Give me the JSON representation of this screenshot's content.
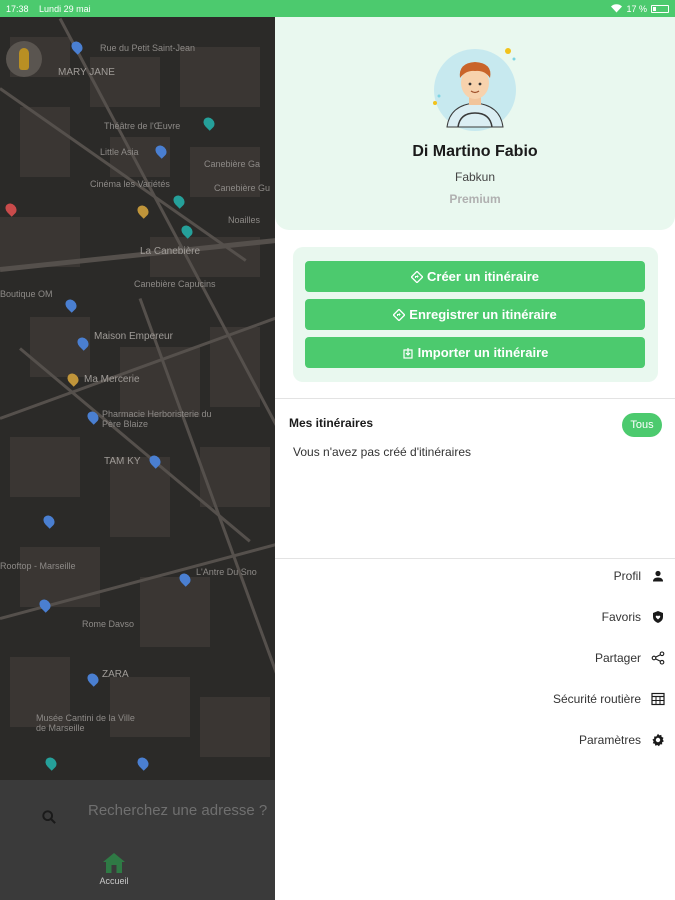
{
  "status_bar": {
    "time": "17:38",
    "date": "Lundi 29 mai",
    "battery": "17 %"
  },
  "map": {
    "labels": [
      "Rue du Petit Saint-Jean",
      "MARY JANE",
      "Théâtre de l'Œuvre",
      "Little Asia",
      "Canebière Ga",
      "Cinéma les Variétés",
      "Canebière Gu",
      "Noailles",
      "La Canebière",
      "Canebière Capucins",
      "Boutique OM",
      "Maison Empereur",
      "Ma Mercerie",
      "Pharmacie Herboristerie du Père Blaize",
      "TAM KY",
      "Rooftop - Marseille",
      "L'Antre Du Sno",
      "Rome Davso",
      "ZARA",
      "Musée Cantini de la Ville de Marseille"
    ],
    "pin_colors": [
      "#4a7fd1",
      "#25a09a",
      "#c0953a",
      "#c94b4b"
    ]
  },
  "search": {
    "placeholder": "Recherchez une adresse ?"
  },
  "bottom_nav": {
    "home_label": "Accueil"
  },
  "profile": {
    "name": "Di Martino Fabio",
    "handle": "Fabkun",
    "plan": "Premium"
  },
  "actions": {
    "create": "Créer un itinéraire",
    "save": "Enregistrer un itinéraire",
    "import": "Importer un itinéraire"
  },
  "itineraries": {
    "title": "Mes itinéraires",
    "filter": "Tous",
    "empty": "Vous n'avez pas créé d'itinéraires"
  },
  "menu": {
    "profile": "Profil",
    "favorites": "Favoris",
    "share": "Partager",
    "road_safety": "Sécurité routière",
    "settings": "Paramètres"
  },
  "colors": {
    "accent": "#4cca6e",
    "light_accent": "#e9f8ef",
    "map_bg": "#2b2a28"
  }
}
